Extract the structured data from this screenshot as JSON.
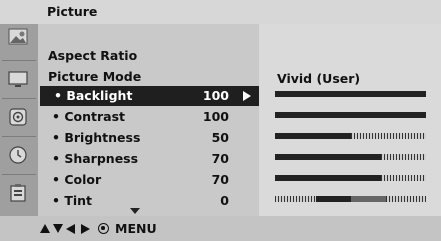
{
  "header": {
    "title": "Picture"
  },
  "sidebar": {
    "icons": [
      {
        "name": "picture-icon"
      },
      {
        "name": "screen-icon"
      },
      {
        "name": "audio-icon"
      },
      {
        "name": "time-icon"
      },
      {
        "name": "lock-icon"
      }
    ]
  },
  "menu": {
    "aspect_ratio_label": "Aspect Ratio",
    "picture_mode_label": "Picture Mode",
    "items": [
      {
        "label": "• Backlight",
        "value": "100",
        "selected": true
      },
      {
        "label": "• Contrast",
        "value": "100",
        "selected": false
      },
      {
        "label": "• Brightness",
        "value": "50",
        "selected": false
      },
      {
        "label": "• Sharpness",
        "value": "70",
        "selected": false
      },
      {
        "label": "• Color",
        "value": "70",
        "selected": false
      },
      {
        "label": "• Tint",
        "value": "0",
        "selected": false
      }
    ]
  },
  "preview": {
    "mode": "Vivid (User)",
    "levels": [
      {
        "item": "Backlight",
        "fraction": 1.0
      },
      {
        "item": "Contrast",
        "fraction": 1.0
      },
      {
        "item": "Brightness",
        "fraction": 0.5
      },
      {
        "item": "Sharpness",
        "fraction": 0.7
      },
      {
        "item": "Color",
        "fraction": 0.7
      },
      {
        "item": "Tint",
        "fraction": 0.5
      }
    ]
  },
  "footer": {
    "menu_label": "MENU"
  }
}
